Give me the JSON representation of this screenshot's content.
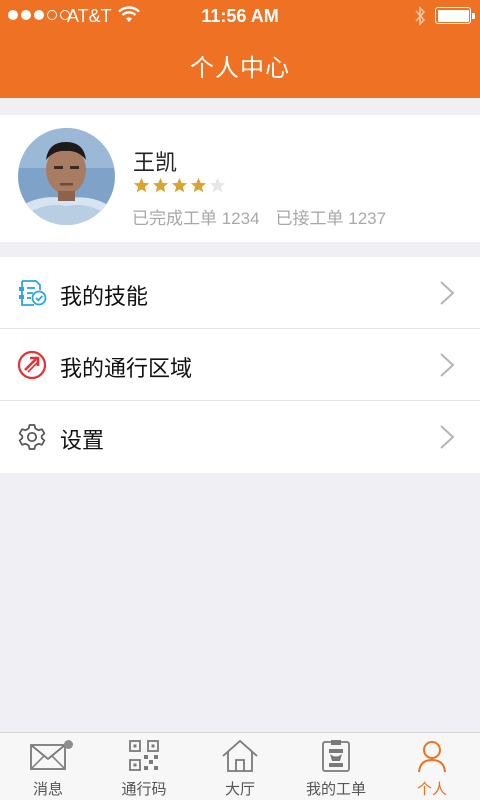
{
  "status_bar": {
    "carrier": "AT&T",
    "time": "11:56 AM",
    "battery_level": 1.0
  },
  "nav": {
    "title": "个人中心"
  },
  "profile": {
    "name": "王凯",
    "rating": 4,
    "rating_max": 5,
    "completed_orders": "已完成工单 1234",
    "accepted_orders": "已接工单 1237",
    "star_color": "#d9a431"
  },
  "menu": {
    "items": [
      {
        "label": "我的技能",
        "icon": "skills-icon"
      },
      {
        "label": "我的通行区域",
        "icon": "access-area-icon"
      },
      {
        "label": "设置",
        "icon": "settings-gear-icon"
      }
    ]
  },
  "tabbar": {
    "tabs": [
      {
        "label": "消息",
        "icon": "message-envelope-icon",
        "active": false,
        "badge": true
      },
      {
        "label": "通行码",
        "icon": "qr-code-icon",
        "active": false
      },
      {
        "label": "大厅",
        "icon": "home-hall-icon",
        "active": false
      },
      {
        "label": "我的工单",
        "icon": "work-order-icon",
        "active": false
      },
      {
        "label": "个人",
        "icon": "person-icon",
        "active": true
      }
    ]
  },
  "colors": {
    "accent": "#ee7124",
    "background": "#efeff4",
    "inactive_icon": "#7a7a7a"
  }
}
